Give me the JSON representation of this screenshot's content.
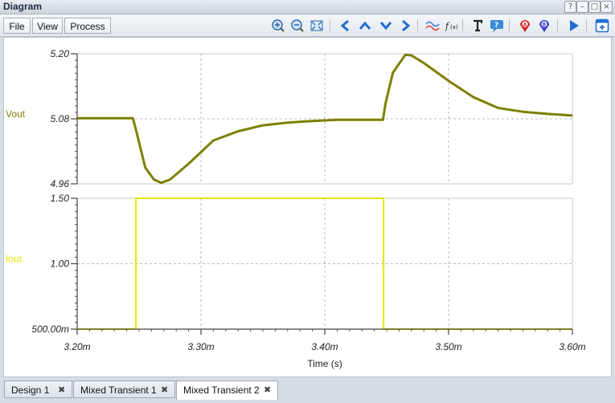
{
  "window": {
    "title": "Diagram",
    "controls": [
      "?",
      "–",
      "□",
      "×"
    ]
  },
  "menu": {
    "file": "File",
    "view": "View",
    "process": "Process"
  },
  "toolbar_icons": [
    "zoom-in-icon",
    "zoom-out-icon",
    "zoom-fit-icon",
    "arrow-left-icon",
    "arrow-up-icon",
    "arrow-down-icon",
    "arrow-right-icon",
    "waveform-icon",
    "function-icon",
    "text-icon",
    "annotation-icon",
    "cursor-a-icon",
    "cursor-b-icon",
    "play-icon",
    "add-window-icon"
  ],
  "chart_data": [
    {
      "type": "line",
      "ylabel": "Vout",
      "color": "#7f7f00",
      "ylim": [
        4.96,
        5.2
      ],
      "yticks": [
        "5.20",
        "5.08",
        "4.96"
      ],
      "xlim": [
        3.2,
        3.6
      ],
      "x": [
        3.2,
        3.245,
        3.2475,
        3.255,
        3.262,
        3.268,
        3.275,
        3.29,
        3.31,
        3.33,
        3.35,
        3.37,
        3.39,
        3.41,
        3.43,
        3.447,
        3.449,
        3.455,
        3.465,
        3.47,
        3.48,
        3.5,
        3.52,
        3.54,
        3.56,
        3.58,
        3.6
      ],
      "y": [
        5.081,
        5.081,
        5.06,
        4.99,
        4.968,
        4.962,
        4.968,
        4.997,
        5.04,
        5.057,
        5.068,
        5.073,
        5.076,
        5.078,
        5.078,
        5.078,
        5.108,
        5.165,
        5.198,
        5.197,
        5.183,
        5.15,
        5.12,
        5.1,
        5.093,
        5.089,
        5.086
      ]
    },
    {
      "type": "line",
      "ylabel": "Iout",
      "color": "#e6e600",
      "ylim": [
        0.5,
        1.5
      ],
      "yticks": [
        "1.50",
        "1.00",
        "500.00m"
      ],
      "xlim": [
        3.2,
        3.6
      ],
      "x": [
        3.2,
        3.2475,
        3.2475,
        3.4475,
        3.4475,
        3.6
      ],
      "y": [
        0.5,
        0.5,
        1.5,
        1.5,
        0.5,
        0.5
      ]
    }
  ],
  "x_axis": {
    "label": "Time (s)",
    "ticks": [
      3.2,
      3.3,
      3.4,
      3.5,
      3.6
    ],
    "tick_labels": [
      "3.20m",
      "3.30m",
      "3.40m",
      "3.50m",
      "3.60m"
    ]
  },
  "tabs": [
    {
      "label": "Design 1",
      "close": "✖"
    },
    {
      "label": "Mixed Transient 1",
      "close": "✖"
    },
    {
      "label": "Mixed Transient 2",
      "close": "✖"
    }
  ]
}
